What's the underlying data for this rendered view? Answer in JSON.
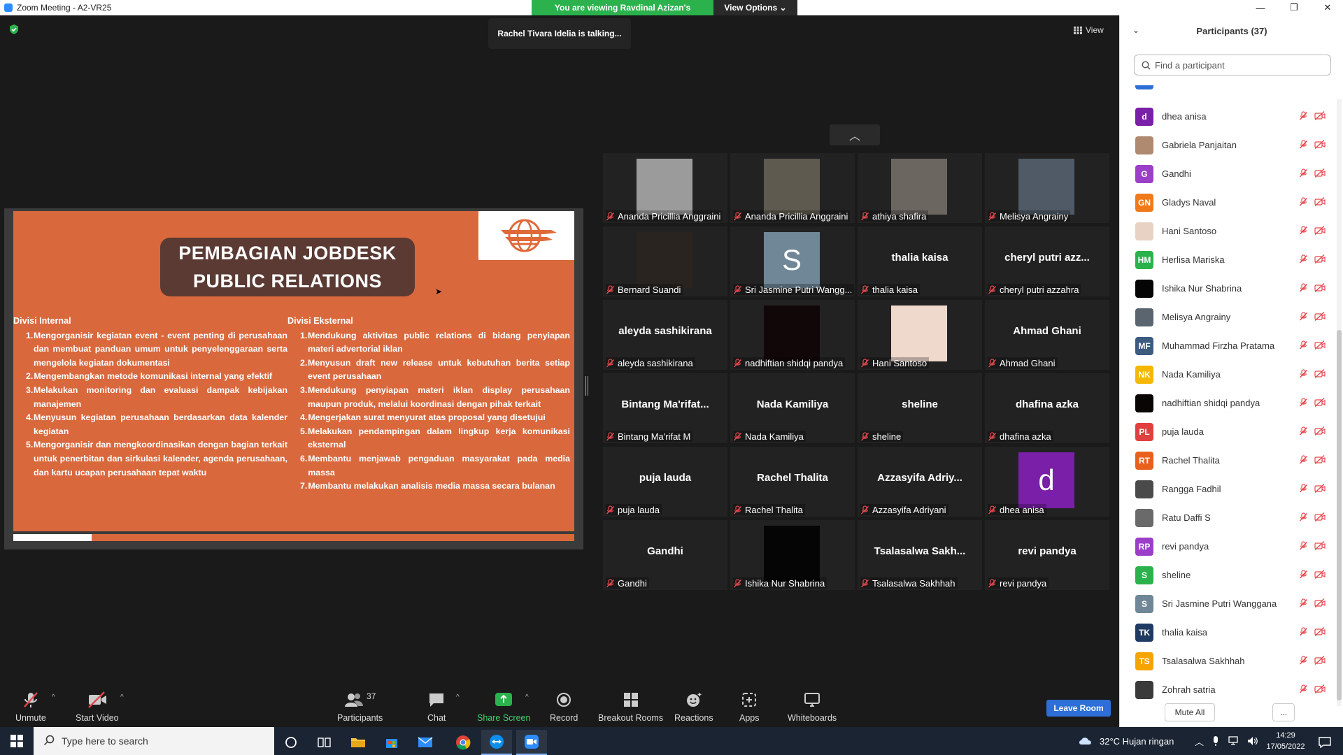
{
  "window": {
    "title": "Zoom Meeting - A2-VR25",
    "minimize": "—",
    "restore": "❐",
    "close": "✕"
  },
  "banner": {
    "viewing": "You are viewing Ravdinal Azizan's screen",
    "view_options": "View Options"
  },
  "talking": "Rachel Tivara Idelia is talking...",
  "view_button": "View",
  "slide": {
    "title_line1": "PEMBAGIAN JOBDESK",
    "title_line2": "PUBLIC RELATIONS",
    "internal": {
      "heading": "Divisi Internal",
      "items": [
        "Mengorganisir kegiatan event - event penting di perusahaan dan membuat panduan umum untuk penyelenggaraan serta mengelola kegiatan dokumentasi",
        "Mengembangkan metode komunikasi internal yang efektif",
        "Melakukan monitoring dan evaluasi dampak kebijakan manajemen",
        "Menyusun kegiatan perusahaan berdasarkan data kalender kegiatan",
        "Mengorganisir dan mengkoordinasikan dengan bagian terkait untuk penerbitan dan sirkulasi kalender, agenda perusahaan, dan kartu ucapan perusahaan tepat waktu"
      ]
    },
    "external": {
      "heading": "Divisi Eksternal",
      "items": [
        "Mendukung aktivitas public relations di bidang penyiapan materi advertorial iklan",
        "Menyusun draft new release untuk kebutuhan berita setiap event perusahaan",
        "Mendukung penyiapan materi iklan display perusahaan maupun produk, melalui koordinasi dengan pihak terkait",
        "Mengerjakan surat menyurat atas proposal yang disetujui",
        "Melakukan pendampingan dalam lingkup kerja komunikasi eksternal",
        "Membantu menjawab pengaduan masyarakat pada media massa",
        "Membantu melakukan analisis media massa secara bulanan"
      ]
    }
  },
  "gallery": [
    {
      "label": "Ananda Pricillia Anggraini",
      "kind": "photo",
      "color": "#9b9b9b"
    },
    {
      "label": "Ananda Pricillia Anggraini",
      "kind": "photo",
      "color": "#5e5a4f"
    },
    {
      "label": "athiya shafira",
      "kind": "photo",
      "color": "#6b6660"
    },
    {
      "label": "Melisya Angrainy",
      "kind": "photo",
      "color": "#4f5a66"
    },
    {
      "label": "Bernard Suandi",
      "kind": "photo",
      "color": "#2a2420"
    },
    {
      "label": "Sri Jasmine Putri Wangg...",
      "kind": "letter",
      "letter": "S",
      "color": "#6f8796"
    },
    {
      "label": "thalia kaisa",
      "kind": "name",
      "big": "thalia kaisa"
    },
    {
      "label": "cheryl putri azzahra",
      "kind": "name",
      "big": "cheryl putri azz..."
    },
    {
      "label": "aleyda sashikirana",
      "kind": "name",
      "big": "aleyda sashikirana"
    },
    {
      "label": "nadhiftian shidqi pandya",
      "kind": "photo",
      "color": "#120708"
    },
    {
      "label": "Hani Santoso",
      "kind": "photo",
      "color": "#efd9cc"
    },
    {
      "label": "Ahmad Ghani",
      "kind": "name",
      "big": "Ahmad Ghani"
    },
    {
      "label": "Bintang Ma'rifat M",
      "kind": "name",
      "big": "Bintang Ma'rifat..."
    },
    {
      "label": "Nada Kamiliya",
      "kind": "name",
      "big": "Nada Kamiliya"
    },
    {
      "label": "sheline",
      "kind": "name",
      "big": "sheline"
    },
    {
      "label": "dhafina azka",
      "kind": "name",
      "big": "dhafina azka"
    },
    {
      "label": "puja lauda",
      "kind": "name",
      "big": "puja lauda"
    },
    {
      "label": "Rachel Thalita",
      "kind": "name",
      "big": "Rachel Thalita"
    },
    {
      "label": "Azzasyifa Adriyani",
      "kind": "name",
      "big": "Azzasyifa Adriy..."
    },
    {
      "label": "dhea anisa",
      "kind": "letter",
      "letter": "d",
      "color": "#7a1fa8"
    },
    {
      "label": "Gandhi",
      "kind": "name",
      "big": "Gandhi"
    },
    {
      "label": "Ishika Nur Shabrina",
      "kind": "photo",
      "color": "#050505"
    },
    {
      "label": "Tsalasalwa Sakhhah",
      "kind": "name",
      "big": "Tsalasalwa Sakh..."
    },
    {
      "label": "revi pandya",
      "kind": "name",
      "big": "revi pandya"
    }
  ],
  "toolbar": {
    "unmute": "Unmute",
    "start_video": "Start Video",
    "participants": "Participants",
    "participants_count": "37",
    "chat": "Chat",
    "share_screen": "Share Screen",
    "record": "Record",
    "breakout": "Breakout Rooms",
    "reactions": "Reactions",
    "apps": "Apps",
    "whiteboards": "Whiteboards",
    "leave": "Leave Room"
  },
  "panel": {
    "title": "Participants (37)",
    "search_placeholder": "Find a participant",
    "mute_all": "Mute All",
    "more": "...",
    "participants": [
      {
        "name": "dhea anisa",
        "initials": "d",
        "color": "#7a1fa8"
      },
      {
        "name": "Gabriela Panjaitan",
        "initials": "",
        "color": "#b08a70"
      },
      {
        "name": "Gandhi",
        "initials": "G",
        "color": "#9b3fc8"
      },
      {
        "name": "Gladys Naval",
        "initials": "GN",
        "color": "#f07a1a"
      },
      {
        "name": "Hani Santoso",
        "initials": "",
        "color": "#e8d2c4"
      },
      {
        "name": "Herlisa Mariska",
        "initials": "HM",
        "color": "#2bb24c"
      },
      {
        "name": "Ishika Nur Shabrina",
        "initials": "",
        "color": "#050505"
      },
      {
        "name": "Melisya Angrainy",
        "initials": "",
        "color": "#5b6570"
      },
      {
        "name": "Muhammad Firzha Pratama",
        "initials": "MF",
        "color": "#3d5a80"
      },
      {
        "name": "Nada Kamiliya",
        "initials": "NK",
        "color": "#f5b800"
      },
      {
        "name": "nadhiftian shidqi pandya",
        "initials": "",
        "color": "#0a0505"
      },
      {
        "name": "puja lauda",
        "initials": "PL",
        "color": "#e04040"
      },
      {
        "name": "Rachel Thalita",
        "initials": "RT",
        "color": "#e8601c"
      },
      {
        "name": "Rangga Fadhil",
        "initials": "",
        "color": "#4a4a4a"
      },
      {
        "name": "Ratu Daffi S",
        "initials": "",
        "color": "#6a6a6a"
      },
      {
        "name": "revi pandya",
        "initials": "RP",
        "color": "#9b3fc8"
      },
      {
        "name": "sheline",
        "initials": "S",
        "color": "#2bb24c"
      },
      {
        "name": "Sri Jasmine Putri Wanggana",
        "initials": "S",
        "color": "#6f8796"
      },
      {
        "name": "thalia kaisa",
        "initials": "TK",
        "color": "#1f3b63"
      },
      {
        "name": "Tsalasalwa Sakhhah",
        "initials": "TS",
        "color": "#f5a400"
      },
      {
        "name": "Zohrah satria",
        "initials": "",
        "color": "#3a3a3a"
      }
    ]
  },
  "taskbar": {
    "search_placeholder": "Type here to search",
    "weather": "32°C  Hujan ringan",
    "time": "14:29",
    "date": "17/05/2022"
  }
}
